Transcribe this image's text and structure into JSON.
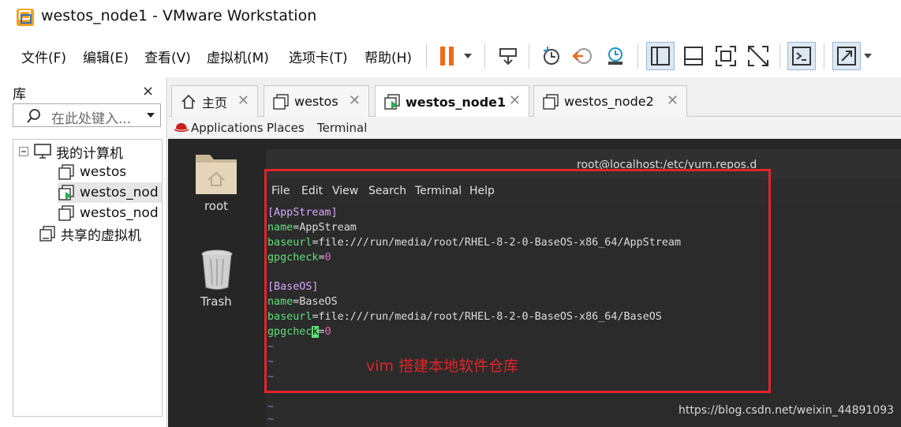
{
  "window": {
    "title": "westos_node1 - VMware Workstation"
  },
  "menu": {
    "items": [
      "文件(F)",
      "编辑(E)",
      "查看(V)",
      "虚拟机(M)",
      "选项卡(T)",
      "帮助(H)"
    ]
  },
  "toolbar": {
    "icons": [
      "pause-icon",
      "send-ctrl-alt-del-icon",
      "snapshot-icon",
      "revert-snapshot-icon",
      "snapshot-manager-icon",
      "show-library-icon",
      "thumbnail-bar-icon",
      "full-screen-icon",
      "unity-icon",
      "console-view-icon",
      "stretch-guest-icon"
    ]
  },
  "library": {
    "title": "库",
    "close": "×",
    "search_placeholder": "在此处键入...",
    "tree": {
      "my_computer": "我的计算机",
      "vms": [
        "westos",
        "westos_nod",
        "westos_nod"
      ],
      "shared": "共享的虚拟机"
    }
  },
  "tabs": [
    {
      "label": "主页",
      "icon": "home-icon"
    },
    {
      "label": "westos",
      "icon": "vm-icon"
    },
    {
      "label": "westos_node1",
      "icon": "vm-running-icon"
    },
    {
      "label": "westos_node2",
      "icon": "vm-icon"
    }
  ],
  "guest_topbar": {
    "applications": "Applications",
    "places": "Places",
    "terminal": "Terminal"
  },
  "desktop": {
    "root_label": "root",
    "trash_label": "Trash"
  },
  "terminal": {
    "title": "root@localhost:/etc/yum.repos.d",
    "menu": [
      "File",
      "Edit",
      "View",
      "Search",
      "Terminal",
      "Help"
    ],
    "lines": {
      "l1": "[AppStream]",
      "l2_key": "name",
      "l2_val": "AppStream",
      "l3_key": "baseurl",
      "l3_val": "file:///run/media/root/RHEL-8-2-0-BaseOS-x86_64/AppStream",
      "l4_key": "gpgcheck",
      "l4_val": "0",
      "l6": "[BaseOS]",
      "l7_key": "name",
      "l7_val": "BaseOS",
      "l8_key": "baseurl",
      "l8_val": "file:///run/media/root/RHEL-8-2-0-BaseOS-x86_64/BaseOS",
      "l9_key_a": "gpgchec",
      "l9_cursor": "k",
      "l9_val": "0",
      "tilde": "~"
    }
  },
  "annotation": {
    "text": "vim 搭建本地软件仓库",
    "color": "#e0252b"
  },
  "watermark": "https://blog.csdn.net/weixin_44891093",
  "colors": {
    "accent": "#e0252b",
    "pause": "#f06a17",
    "terminal_bg": "#2b2b2b",
    "key_green": "#5fe07a"
  }
}
